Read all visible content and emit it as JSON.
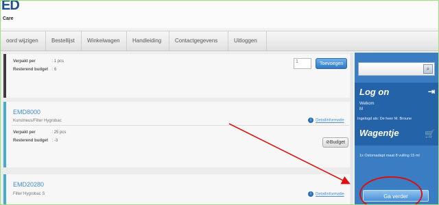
{
  "header": {
    "logo_text": "ED",
    "logo_sub": "Care"
  },
  "nav": {
    "items": [
      {
        "label": "oord wijzigen"
      },
      {
        "label": "Bestellijst"
      },
      {
        "label": "Winkelwagen"
      },
      {
        "label": "Handleiding"
      },
      {
        "label": "Contactgegevens"
      },
      {
        "label": "Uitloggen"
      }
    ]
  },
  "products": [
    {
      "verpakt_label": "Verpakt per",
      "verpakt_value": ": 1 pcs",
      "budget_label": "Resterend budget",
      "budget_value": ": 6",
      "qty_value": "1",
      "add_label": "Toevoegen"
    },
    {
      "code": "EMD8000",
      "description": "Kunstneus/Filter Hygrobac",
      "info_link": "Detailinformatie",
      "verpakt_label": "Verpakt per",
      "verpakt_value": ": 25 pcs",
      "budget_label": "Resterend budget",
      "budget_value": ": -3",
      "budget_button": "Budget"
    },
    {
      "code": "EMD20280",
      "description": "Filter Hygrobac S",
      "info_link": "Detailinformatie"
    }
  ],
  "sidebar": {
    "logon_title": "Log on",
    "welcome_label": "Welkom",
    "welcome_value": "M",
    "logged_in_text": "Ingelogd als: De heer M. Broune",
    "cart_title": "Wagentje",
    "cart_line": "1x Ostomadapt maat 8 vulling 15 ml",
    "continue_button": "Ga verder"
  },
  "colors": {
    "accent_blue": "#3a7dc2",
    "annotation_red": "#e01010"
  }
}
